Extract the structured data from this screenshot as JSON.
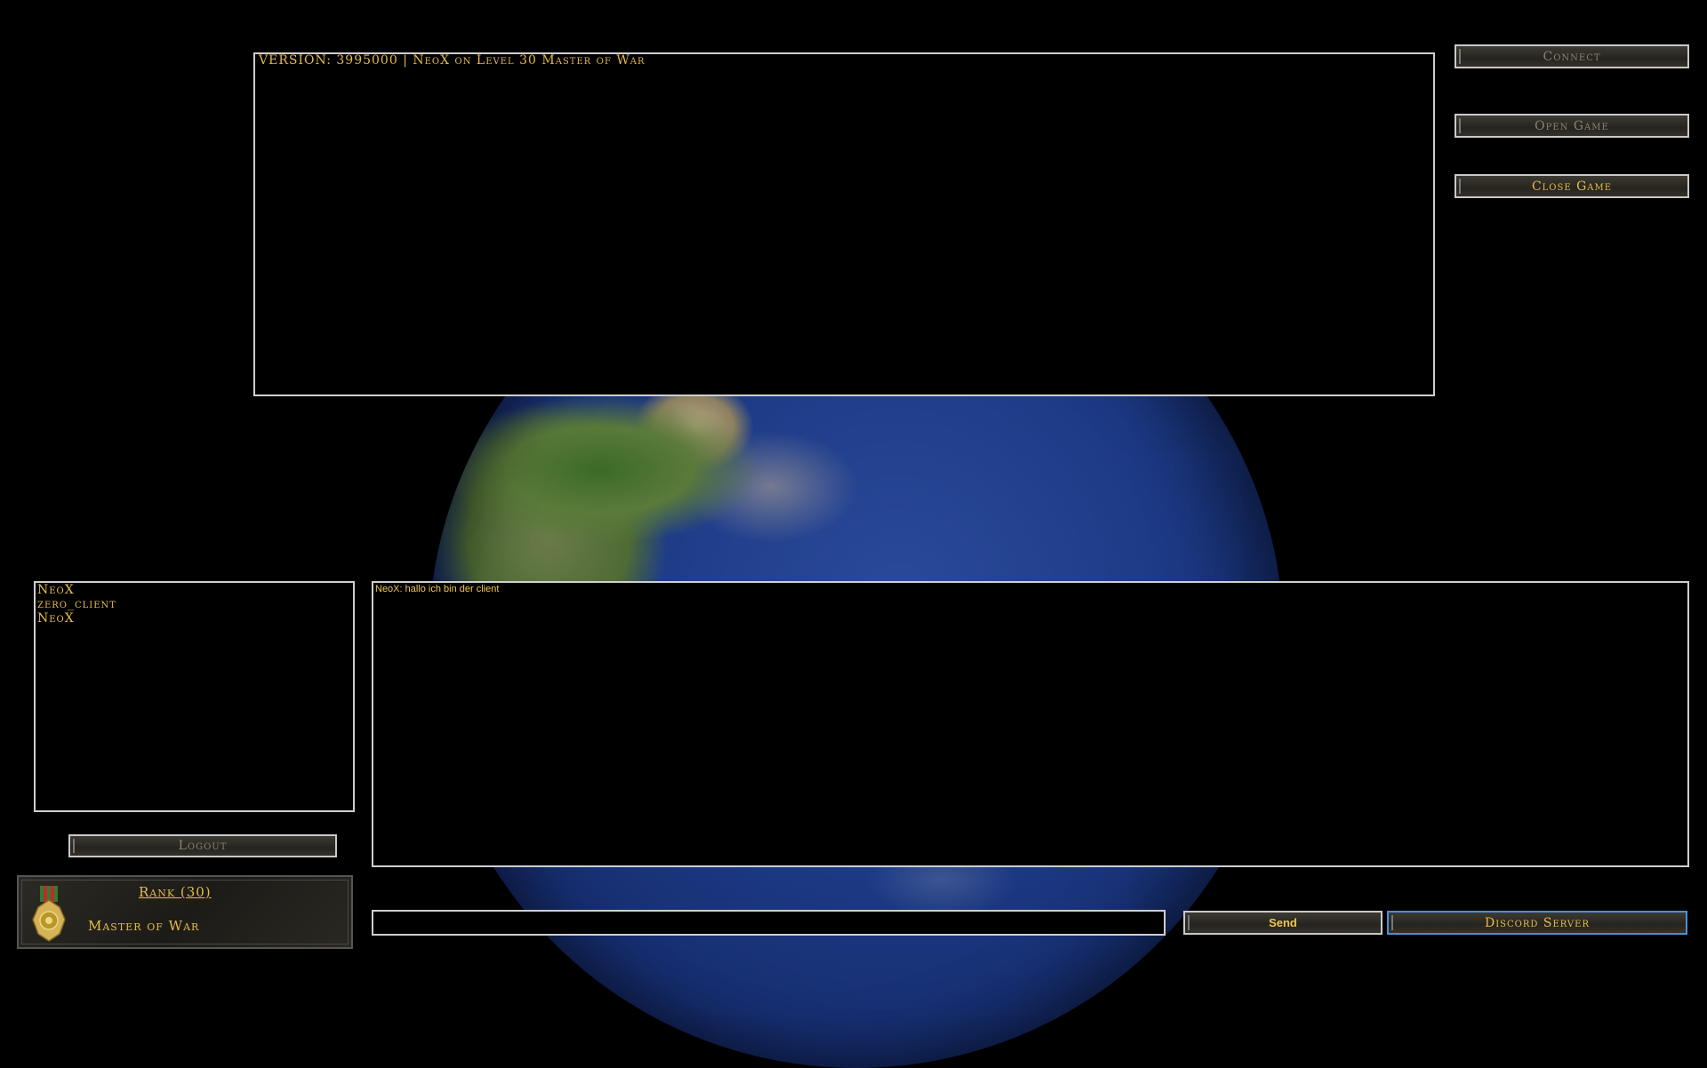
{
  "version_text": "VERSION: 3995000 | NeoX on Level 30 Master of War",
  "buttons": {
    "connect": "Connect",
    "open_game": "Open Game",
    "close_game": "Close Game",
    "logout": "Logout",
    "send": "Send",
    "discord": "Discord Server"
  },
  "players": [
    "NeoX",
    "zero_client",
    "NeoX"
  ],
  "chat_messages": [
    "NeoX: hallo ich bin der client"
  ],
  "chat_input": {
    "value": "",
    "placeholder": ""
  },
  "rank": {
    "title": "Rank (30)",
    "name": "Master of War"
  },
  "colors": {
    "accent_gold": "#e6bd4c",
    "disabled_text": "#8a8472",
    "focus_border": "#4a8fd8"
  }
}
